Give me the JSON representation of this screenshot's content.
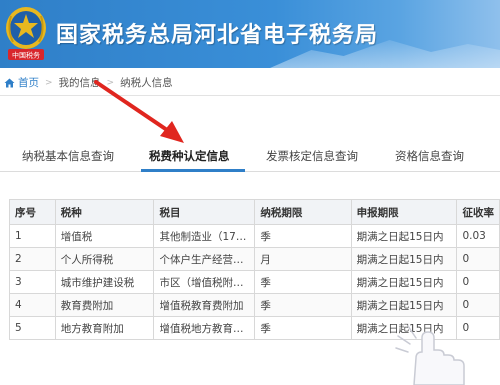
{
  "header": {
    "title": "国家税务总局河北省电子税务局",
    "emblem_caption": "中国税务",
    "colors": {
      "banner": "#2f7fc8",
      "emblem_red": "#d8262c",
      "emblem_gold": "#e8b820"
    }
  },
  "breadcrumb": {
    "home": "首页",
    "items": [
      "我的信息",
      "纳税人信息"
    ]
  },
  "tabs": [
    {
      "label": "纳税基本信息查询",
      "active": false
    },
    {
      "label": "税费种认定信息",
      "active": true
    },
    {
      "label": "发票核定信息查询",
      "active": false
    },
    {
      "label": "资格信息查询",
      "active": false
    }
  ],
  "table": {
    "headers": [
      "序号",
      "税种",
      "税目",
      "纳税期限",
      "申报期限",
      "征收率"
    ],
    "rows": [
      [
        "1",
        "增值税",
        "其他制造业（17…",
        "季",
        "期满之日起15日内",
        "0.03"
      ],
      [
        "2",
        "个人所得税",
        "个体户生产经营…",
        "月",
        "期满之日起15日内",
        "0"
      ],
      [
        "3",
        "城市维护建设税",
        "市区（增值税附…",
        "季",
        "期满之日起15日内",
        "0"
      ],
      [
        "4",
        "教育费附加",
        "增值税教育费附加",
        "季",
        "期满之日起15日内",
        "0"
      ],
      [
        "5",
        "地方教育附加",
        "增值税地方教育…",
        "季",
        "期满之日起15日内",
        "0"
      ]
    ]
  },
  "icons": {
    "home": "home-icon",
    "separator": "chevron-right-icon",
    "annotation": "red-arrow-annotation",
    "cursor": "hand-pointer-icon"
  },
  "accent_color": "#2f7fc8",
  "annotation_color": "#e0261f"
}
